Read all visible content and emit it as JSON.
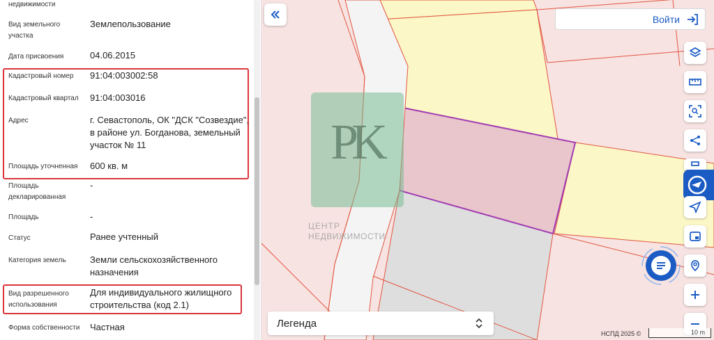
{
  "panel": {
    "top_cut_label": "недвижимости",
    "rows": [
      {
        "label": "Вид земельного участка",
        "value": "Землепользование"
      },
      {
        "label": "Дата присвоения",
        "value": "04.06.2015"
      },
      {
        "label": "Кадастровый номер",
        "value": "91:04:003002:58"
      },
      {
        "label": "Кадастровый квартал",
        "value": "91:04:003016"
      },
      {
        "label": "Адрес",
        "value": "г. Севастополь, ОК \"ДСК \"Созвездие\", в районе ул. Богданова, земельный участок № 11"
      },
      {
        "label": "Площадь уточненная",
        "value": "600 кв. м"
      },
      {
        "label": "Площадь декларированная",
        "value": "-"
      },
      {
        "label": "Площадь",
        "value": "-"
      },
      {
        "label": "Статус",
        "value": "Ранее учтенный"
      },
      {
        "label": "Категория земель",
        "value": "Земли сельскохозяйственного назначения"
      },
      {
        "label": "Вид разрешенного использования",
        "value": "Для индивидуального жилищного строительства (код 2.1)"
      },
      {
        "label": "Форма собственности",
        "value": "Частная"
      }
    ]
  },
  "map": {
    "collapse_icon": "double-chevron-left-icon",
    "login_label": "Войти",
    "login_icon": "login-arrow-icon",
    "watermark_letters": "PK",
    "watermark_line1": "ЦЕНТР",
    "watermark_line2": "НЕДВИЖИМОСТИ",
    "legend_label": "Легенда",
    "copyright": "НСПД 2025 ©",
    "scale_label": "10 m",
    "tools": [
      "layers-icon",
      "ruler-icon",
      "area-select-icon",
      "share-icon",
      "print-icon",
      "navigate-icon",
      "panel-icon",
      "location-search-icon",
      "zoom-in-icon",
      "zoom-out-icon"
    ],
    "colors": {
      "accent": "#1a5bc4",
      "parcel_pink": "#f7e3e2",
      "parcel_yellow": "#fbf7c6",
      "selected_parcel": "#e9c6cc",
      "selected_outline": "#a13bb3",
      "gray_parcel": "#dedede",
      "boundary_red": "#e2553f",
      "highlight_red": "#d9343a"
    }
  }
}
